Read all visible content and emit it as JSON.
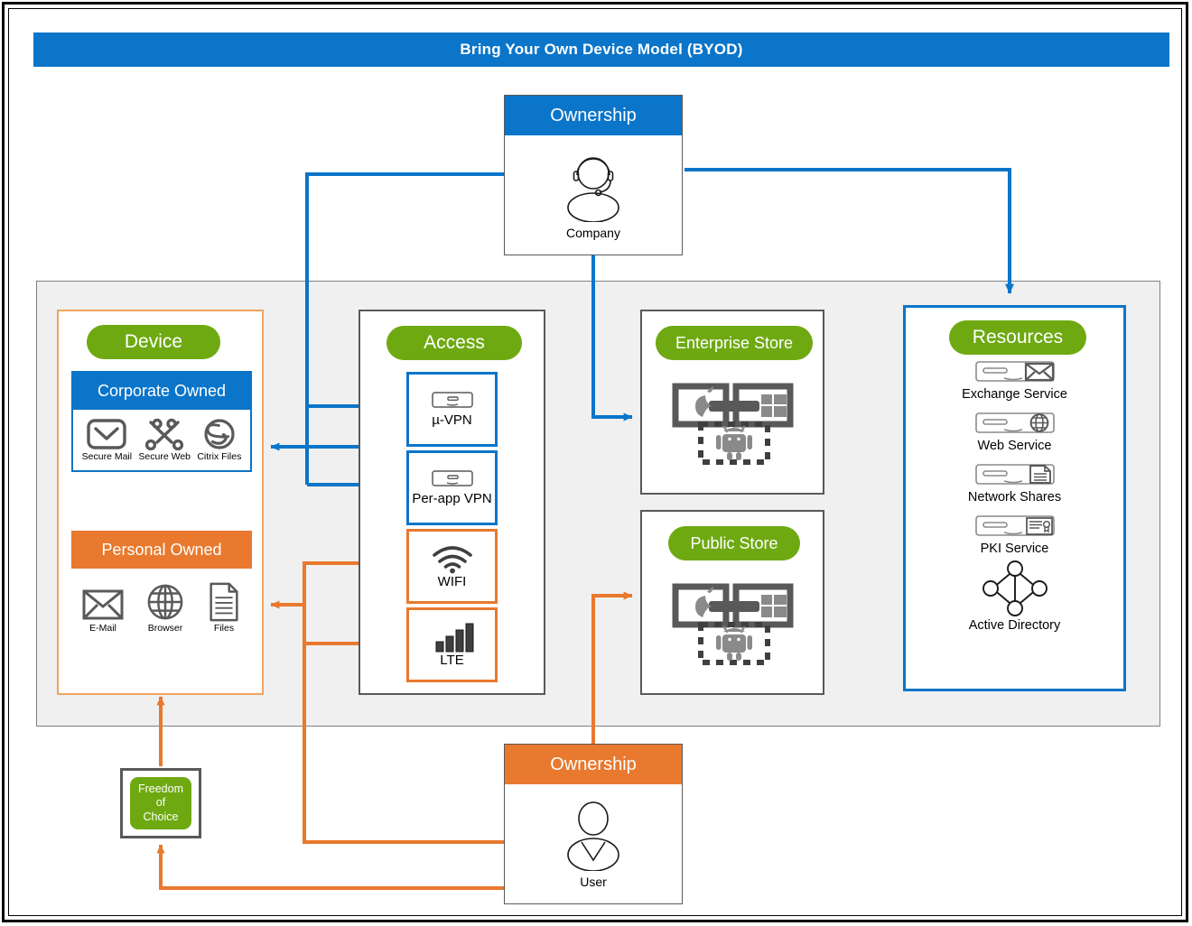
{
  "title": "Bring Your Own Device Model (BYOD)",
  "colors": {
    "blue": "#0B75C9",
    "orange": "#E8792E",
    "green": "#6EA912",
    "gray": "#595959",
    "panel_bg": "#F0F0F0"
  },
  "ownership_company": {
    "header": "Ownership",
    "caption": "Company",
    "icon": "person-headset-icon",
    "accent": "#0B75C9"
  },
  "ownership_user": {
    "header": "Ownership",
    "caption": "User",
    "icon": "person-icon",
    "accent": "#E8792E"
  },
  "freedom_of_choice": {
    "line1": "Freedom",
    "line2": "of",
    "line3": "Choice"
  },
  "device": {
    "title": "Device",
    "corporate": {
      "title": "Corporate Owned",
      "apps": [
        {
          "label": "Secure Mail",
          "icon": "secure-mail-icon"
        },
        {
          "label": "Secure Web",
          "icon": "secure-web-icon"
        },
        {
          "label": "Citrix Files",
          "icon": "citrix-files-icon"
        }
      ]
    },
    "personal": {
      "title": "Personal Owned",
      "apps": [
        {
          "label": "E-Mail",
          "icon": "envelope-icon"
        },
        {
          "label": "Browser",
          "icon": "globe-icon"
        },
        {
          "label": "Files",
          "icon": "document-icon"
        }
      ]
    }
  },
  "access": {
    "title": "Access",
    "items": [
      {
        "label": "µ-VPN",
        "icon": "server-icon",
        "accent": "#0B75C9"
      },
      {
        "label": "Per-app VPN",
        "icon": "server-icon",
        "accent": "#0B75C9"
      },
      {
        "label": "WIFI",
        "icon": "wifi-icon",
        "accent": "#E8792E"
      },
      {
        "label": "LTE",
        "icon": "signal-bars-icon",
        "accent": "#E8792E"
      }
    ]
  },
  "stores": [
    {
      "title": "Enterprise Store",
      "icon": "app-store-platforms-icon"
    },
    {
      "title": "Public Store",
      "icon": "app-store-platforms-icon"
    }
  ],
  "resources": {
    "title": "Resources",
    "items": [
      {
        "label": "Exchange Service",
        "icon": "server-mail-icon"
      },
      {
        "label": "Web Service",
        "icon": "server-globe-icon"
      },
      {
        "label": "Network Shares",
        "icon": "server-document-icon"
      },
      {
        "label": "PKI Service",
        "icon": "server-certificate-icon"
      },
      {
        "label": "Active Directory",
        "icon": "directory-tree-icon"
      }
    ]
  }
}
